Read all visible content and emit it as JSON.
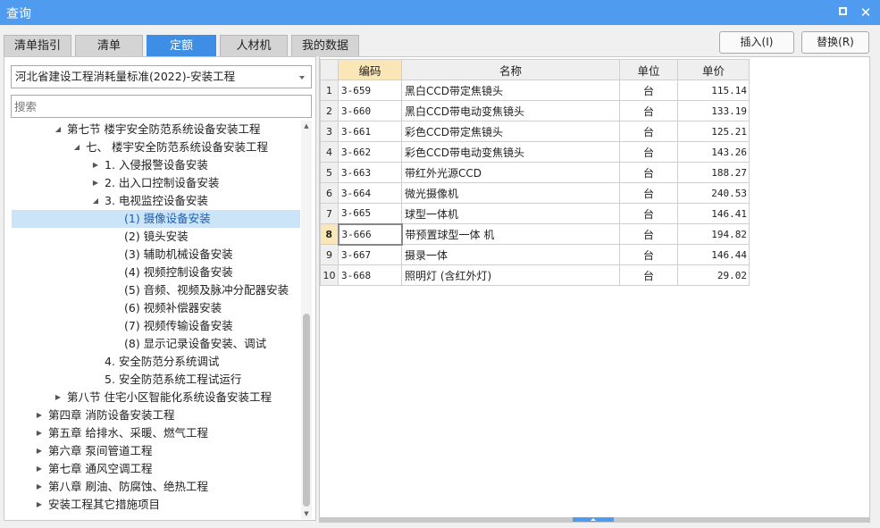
{
  "window": {
    "title": "查询"
  },
  "tabs": [
    {
      "label": "清单指引"
    },
    {
      "label": "清单"
    },
    {
      "label": "定额"
    },
    {
      "label": "人材机"
    },
    {
      "label": "我的数据"
    }
  ],
  "toolbar": {
    "insert_label": "插入(I)",
    "replace_label": "替换(R)"
  },
  "left": {
    "library": "河北省建设工程消耗量标准(2022)-安装工程",
    "search_placeholder": "搜索",
    "tree": [
      {
        "label": "第七节 楼宇安全防范系统设备安装工程",
        "expanded": true
      },
      {
        "label": "七、 楼宇安全防范系统设备安装工程",
        "expanded": true
      },
      {
        "label": "1. 入侵报警设备安装",
        "expanded": false
      },
      {
        "label": "2. 出入口控制设备安装",
        "expanded": false
      },
      {
        "label": "3. 电视监控设备安装",
        "expanded": true
      },
      {
        "label": "(1) 摄像设备安装",
        "selected": true
      },
      {
        "label": "(2) 镜头安装"
      },
      {
        "label": "(3) 辅助机械设备安装"
      },
      {
        "label": "(4) 视频控制设备安装"
      },
      {
        "label": "(5) 音频、视频及脉冲分配器安装"
      },
      {
        "label": "(6) 视频补偿器安装"
      },
      {
        "label": "(7) 视频传输设备安装"
      },
      {
        "label": "(8) 显示记录设备安装、调试"
      },
      {
        "label": "4. 安全防范分系统调试"
      },
      {
        "label": "5. 安全防范系统工程试运行"
      },
      {
        "label": "第八节 住宅小区智能化系统设备安装工程",
        "expanded": false
      },
      {
        "label": "第四章 消防设备安装工程",
        "expanded": false
      },
      {
        "label": "第五章 给排水、采暖、燃气工程",
        "expanded": false
      },
      {
        "label": "第六章 泵间管道工程",
        "expanded": false
      },
      {
        "label": "第七章 通风空调工程",
        "expanded": false
      },
      {
        "label": "第八章 刷油、防腐蚀、绝热工程",
        "expanded": false
      },
      {
        "label": "安装工程其它措施项目",
        "expanded": false
      }
    ]
  },
  "grid": {
    "columns": [
      "编码",
      "名称",
      "单位",
      "单价"
    ],
    "current_row": 8,
    "rows": [
      {
        "no": "1",
        "code": "3-659",
        "name": "黑白CCD带定焦镜头",
        "unit": "台",
        "price": "115.14"
      },
      {
        "no": "2",
        "code": "3-660",
        "name": "黑白CCD带电动变焦镜头",
        "unit": "台",
        "price": "133.19"
      },
      {
        "no": "3",
        "code": "3-661",
        "name": "彩色CCD带定焦镜头",
        "unit": "台",
        "price": "125.21"
      },
      {
        "no": "4",
        "code": "3-662",
        "name": "彩色CCD带电动变焦镜头",
        "unit": "台",
        "price": "143.26"
      },
      {
        "no": "5",
        "code": "3-663",
        "name": "带红外光源CCD",
        "unit": "台",
        "price": "188.27"
      },
      {
        "no": "6",
        "code": "3-664",
        "name": "微光摄像机",
        "unit": "台",
        "price": "240.53"
      },
      {
        "no": "7",
        "code": "3-665",
        "name": "球型一体机",
        "unit": "台",
        "price": "146.41"
      },
      {
        "no": "8",
        "code": "3-666",
        "name": "带预置球型一体 机",
        "unit": "台",
        "price": "194.82"
      },
      {
        "no": "9",
        "code": "3-667",
        "name": "摄录一体",
        "unit": "台",
        "price": "146.44"
      },
      {
        "no": "10",
        "code": "3-668",
        "name": "照明灯 (含红外灯)",
        "unit": "台",
        "price": "29.02"
      }
    ]
  }
}
